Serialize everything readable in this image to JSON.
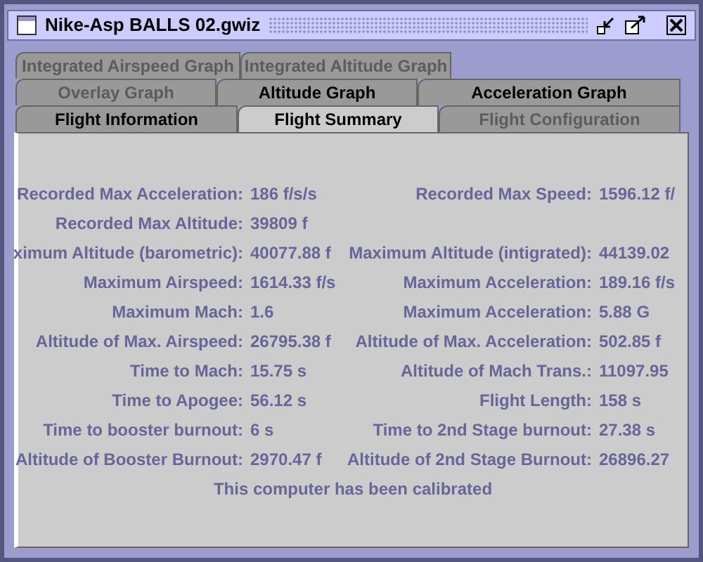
{
  "window": {
    "title": "Nike-Asp BALLS 02.gwiz"
  },
  "tab_rows": [
    [
      {
        "label": "Integrated Airspeed Graph",
        "selected": false,
        "disabled": true
      },
      {
        "label": "Integrated Altitude Graph",
        "selected": false,
        "disabled": true
      }
    ],
    [
      {
        "label": "Overlay Graph",
        "selected": false,
        "disabled": true
      },
      {
        "label": "Altitude Graph",
        "selected": false,
        "disabled": false
      },
      {
        "label": "Acceleration Graph",
        "selected": false,
        "disabled": false
      }
    ],
    [
      {
        "label": "Flight Information",
        "selected": false,
        "disabled": false
      },
      {
        "label": "Flight Summary",
        "selected": true,
        "disabled": false
      },
      {
        "label": "Flight Configuration",
        "selected": false,
        "disabled": true
      }
    ]
  ],
  "summary_rows": [
    {
      "left": {
        "label": "Recorded Max Acceleration:",
        "value": "186 f/s/s"
      },
      "right": {
        "label": "Recorded Max Speed:",
        "value": "1596.12 f/"
      }
    },
    {
      "left": {
        "label": "Recorded Max Altitude:",
        "value": "39809 f"
      }
    },
    {
      "left": {
        "label": "ximum Altitude (barometric):",
        "value": "40077.88 f"
      },
      "right": {
        "label": "Maximum Altitude (intigrated):",
        "value": "44139.02"
      }
    },
    {
      "left": {
        "label": "Maximum Airspeed:",
        "value": "1614.33 f/s"
      },
      "right": {
        "label": "Maximum Acceleration:",
        "value": "189.16 f/s"
      }
    },
    {
      "left": {
        "label": "Maximum Mach:",
        "value": "1.6"
      },
      "right": {
        "label": "Maximum Acceleration:",
        "value": "5.88 G"
      }
    },
    {
      "left": {
        "label": "Altitude of Max. Airspeed:",
        "value": "26795.38 f"
      },
      "right": {
        "label": "Altitude of Max. Acceleration:",
        "value": "502.85 f"
      }
    },
    {
      "left": {
        "label": "Time to Mach:",
        "value": "15.75 s"
      },
      "right": {
        "label": "Altitude of Mach Trans.:",
        "value": "11097.95"
      }
    },
    {
      "left": {
        "label": "Time to Apogee:",
        "value": "56.12 s"
      },
      "right": {
        "label": "Flight Length:",
        "value": "158 s"
      }
    },
    {
      "left": {
        "label": "Time to booster burnout:",
        "value": "6 s"
      },
      "right": {
        "label": "Time to 2nd Stage burnout:",
        "value": "27.38 s"
      }
    },
    {
      "left": {
        "label": "Altitude of Booster Burnout:",
        "value": "2970.47 f"
      },
      "right": {
        "label": "Altitude of 2nd Stage Burnout:",
        "value": "26896.27"
      }
    }
  ],
  "status_message": "This computer has been calibrated"
}
